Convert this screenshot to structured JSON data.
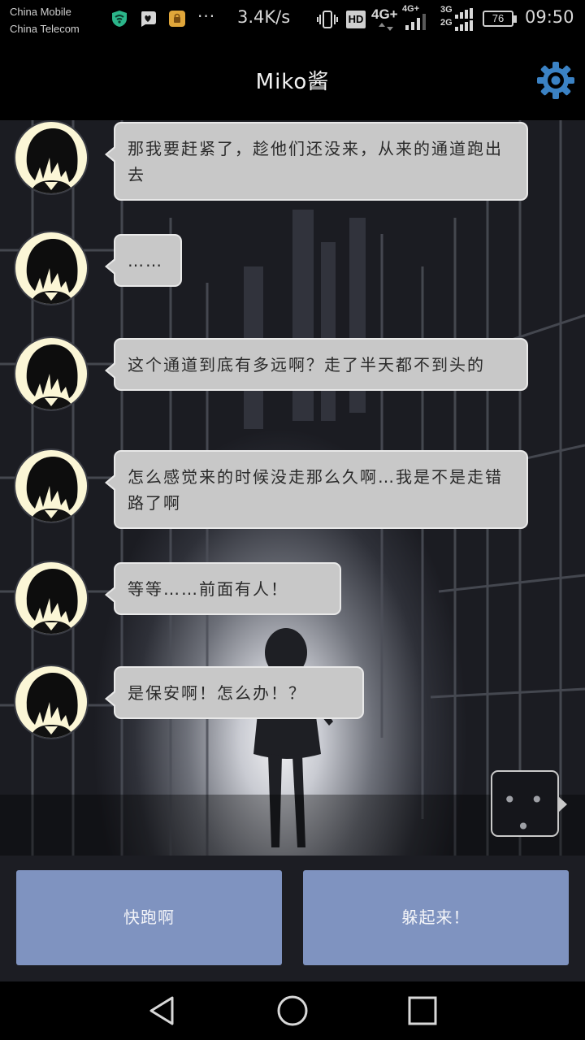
{
  "status_bar": {
    "carrier_1": "China Mobile",
    "carrier_2": "China Telecom",
    "more_indicator": "···",
    "network_speed": "3.4K/s",
    "hd_label": "HD",
    "network_1": "4G+",
    "network_2": "4G+",
    "network_3": "3G",
    "network_4": "2G",
    "battery_level": "76",
    "time": "09:50"
  },
  "header": {
    "title": "Miko酱",
    "settings_icon": "gear-icon"
  },
  "messages": [
    {
      "text": "那我要赶紧了，趁他们还没来，从来的通道跑出去"
    },
    {
      "text": "……"
    },
    {
      "text": "这个通道到底有多远啊？走了半天都不到头的"
    },
    {
      "text": "怎么感觉来的时候没走那么久啊…我是不是走错路了啊"
    },
    {
      "text": "等等……前面有人！"
    },
    {
      "text": "是保安啊！怎么办！？"
    }
  ],
  "typing_indicator": {
    "dots": "• • •"
  },
  "choices": [
    {
      "label": "快跑啊"
    },
    {
      "label": "躲起来！"
    }
  ],
  "nav_bar": {
    "back_icon": "triangle-back-icon",
    "home_icon": "circle-home-icon",
    "recents_icon": "square-recents-icon"
  },
  "colors": {
    "bubble_bg": "#c8c8c8",
    "choice_bg": "#7f93c0",
    "avatar_bg": "#fbf6d6",
    "gear_color": "#3b82c4"
  }
}
